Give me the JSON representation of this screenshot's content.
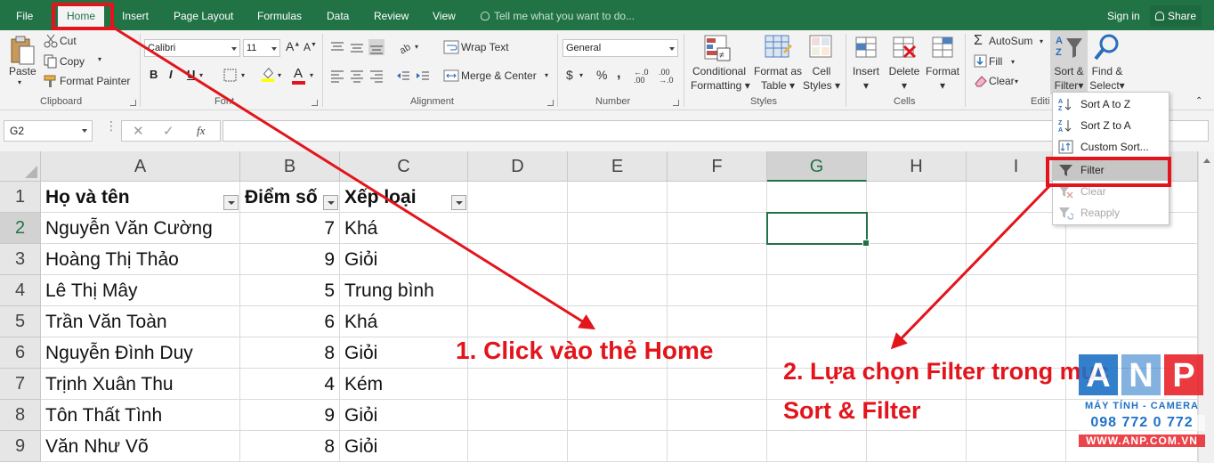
{
  "tabs": {
    "file": "File",
    "home": "Home",
    "insert": "Insert",
    "page_layout": "Page Layout",
    "formulas": "Formulas",
    "data": "Data",
    "review": "Review",
    "view": "View",
    "tell_me": "Tell me what you want to do...",
    "sign_in": "Sign in",
    "share": "Share"
  },
  "ribbon": {
    "clipboard": {
      "paste": "Paste",
      "cut": "Cut",
      "copy": "Copy",
      "format_painter": "Format Painter",
      "label": "Clipboard"
    },
    "font": {
      "name": "Calibri",
      "size": "11",
      "label": "Font",
      "bold": "B",
      "italic": "I",
      "underline": "U"
    },
    "alignment": {
      "wrap_text": "Wrap Text",
      "merge_center": "Merge & Center",
      "label": "Alignment"
    },
    "number": {
      "format": "General",
      "currency": "$",
      "percent": "%",
      "comma": ",",
      "label": "Number"
    },
    "styles": {
      "conditional_1": "Conditional",
      "conditional_2": "Formatting",
      "format_table_1": "Format as",
      "format_table_2": "Table",
      "cell_styles_1": "Cell",
      "cell_styles_2": "Styles",
      "label": "Styles"
    },
    "cells": {
      "insert": "Insert",
      "delete": "Delete",
      "format": "Format",
      "label": "Cells"
    },
    "editing": {
      "autosum": "AutoSum",
      "fill": "Fill",
      "clear": "Clear",
      "sort_filter_1": "Sort &",
      "sort_filter_2": "Filter",
      "find_select_1": "Find &",
      "find_select_2": "Select",
      "label": "Editi"
    }
  },
  "formula_bar": {
    "name_box": "G2",
    "fx": "fx",
    "value": ""
  },
  "columns": [
    "A",
    "B",
    "C",
    "D",
    "E",
    "F",
    "G",
    "H",
    "I"
  ],
  "rows": [
    "1",
    "2",
    "3",
    "4",
    "5",
    "6",
    "7",
    "8",
    "9"
  ],
  "selected_cell": "G2",
  "table": {
    "headers": [
      "Họ và tên",
      "Điểm số",
      "Xếp loại"
    ],
    "data": [
      [
        "Nguyễn Văn Cường",
        "7",
        "Khá"
      ],
      [
        "Hoàng Thị Thảo",
        "9",
        "Giỏi"
      ],
      [
        "Lê Thị Mây",
        "5",
        "Trung bình"
      ],
      [
        "Trần Văn Toàn",
        "6",
        "Khá"
      ],
      [
        "Nguyễn Đình Duy",
        "8",
        "Giỏi"
      ],
      [
        "Trịnh Xuân Thu",
        "4",
        "Kém"
      ],
      [
        "Tôn Thất Tình",
        "9",
        "Giỏi"
      ],
      [
        "Văn Như Võ",
        "8",
        "Giỏi"
      ]
    ]
  },
  "sort_filter_menu": {
    "sort_az": "Sort A to Z",
    "sort_za": "Sort Z to A",
    "custom_sort": "Custom Sort...",
    "filter": "Filter",
    "clear": "Clear",
    "reapply": "Reapply"
  },
  "annotations": {
    "step1": "1. Click vào thẻ Home",
    "step2_line1": "2. Lựa chọn Filter trong mục",
    "step2_line2": "Sort & Filter"
  },
  "watermark": {
    "letters": [
      "A",
      "N",
      "P"
    ],
    "tagline": "MÁY TÍNH - CAMERA",
    "phone": "098 772 0 772",
    "website": "WWW.ANP.COM.VN"
  },
  "colors": {
    "excel_green": "#217346",
    "annotation_red": "#e3141b",
    "wm_blue": "#1f72c7",
    "wm_red": "#e8242b"
  }
}
